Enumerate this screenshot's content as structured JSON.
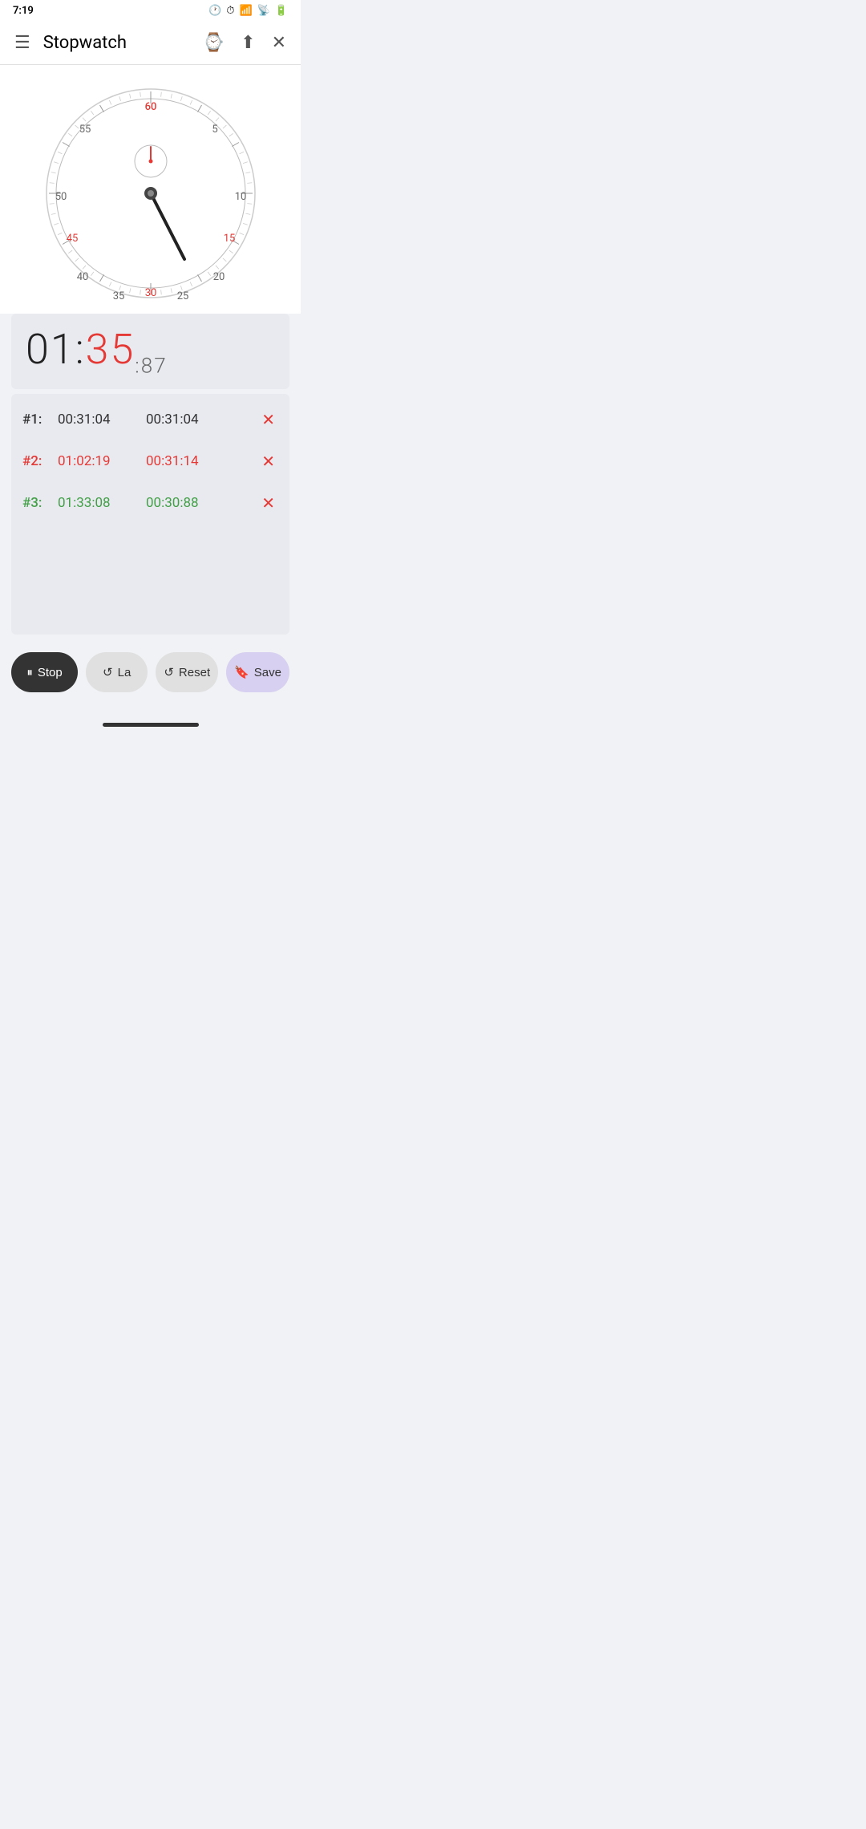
{
  "status": {
    "time": "7:19",
    "icons": [
      "📶",
      "🔋"
    ]
  },
  "appBar": {
    "title": "Stopwatch",
    "menuIcon": "☰",
    "watchIcon": "⌚",
    "shareIcon": "↑",
    "closeIcon": "✕"
  },
  "clock": {
    "labels": {
      "top": "60",
      "top_left": "55",
      "top_right": "5",
      "left_upper": "50",
      "right_upper": "10",
      "left_mid": "45",
      "right_mid": "15",
      "left_lower": "40",
      "right_lower": "20",
      "bot_left": "35",
      "bot_right": "25",
      "bottom": "30"
    }
  },
  "timeDisplay": {
    "hours": "01",
    "separator1": ":",
    "minutes": "35",
    "separator2": ":",
    "centiseconds": "87"
  },
  "laps": [
    {
      "number": "#1:",
      "total": "00:31:04",
      "split": "00:31:04",
      "style": "normal"
    },
    {
      "number": "#2:",
      "total": "01:02:19",
      "split": "00:31:14",
      "style": "red"
    },
    {
      "number": "#3:",
      "total": "01:33:08",
      "split": "00:30:88",
      "style": "green"
    }
  ],
  "buttons": {
    "stop": "Stop",
    "lap": "La",
    "reset": "Reset",
    "save": "Save"
  }
}
